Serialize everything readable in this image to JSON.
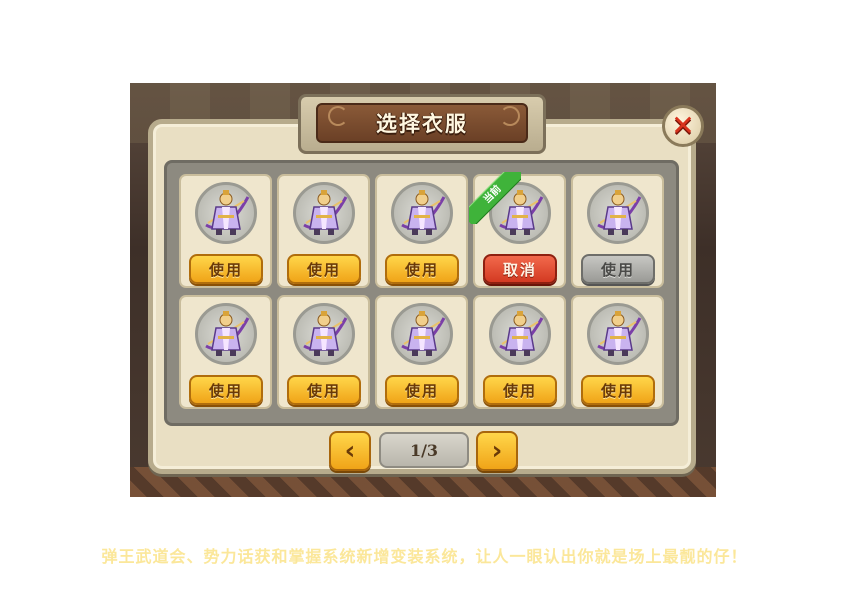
{
  "title": "选择衣服",
  "close_label": "✕",
  "ribbon_label": "当前",
  "outfits": [
    {
      "button": "使用",
      "state": "use"
    },
    {
      "button": "使用",
      "state": "use"
    },
    {
      "button": "使用",
      "state": "use"
    },
    {
      "button": "取消",
      "state": "cancel",
      "current": true
    },
    {
      "button": "使用",
      "state": "disabled"
    },
    {
      "button": "使用",
      "state": "use"
    },
    {
      "button": "使用",
      "state": "use"
    },
    {
      "button": "使用",
      "state": "use"
    },
    {
      "button": "使用",
      "state": "use"
    },
    {
      "button": "使用",
      "state": "use"
    }
  ],
  "pager": {
    "prev": "‹",
    "next": "›",
    "indicator": "1/3"
  },
  "caption": "弹王武道会、势力话获和掌握系统新增变装系统，让人一眼认出你就是场上最靓的仔！",
  "colors": {
    "use": "#f0a418",
    "cancel": "#d33a22",
    "disabled": "#9a9a96",
    "ribbon": "#3fb33a"
  }
}
